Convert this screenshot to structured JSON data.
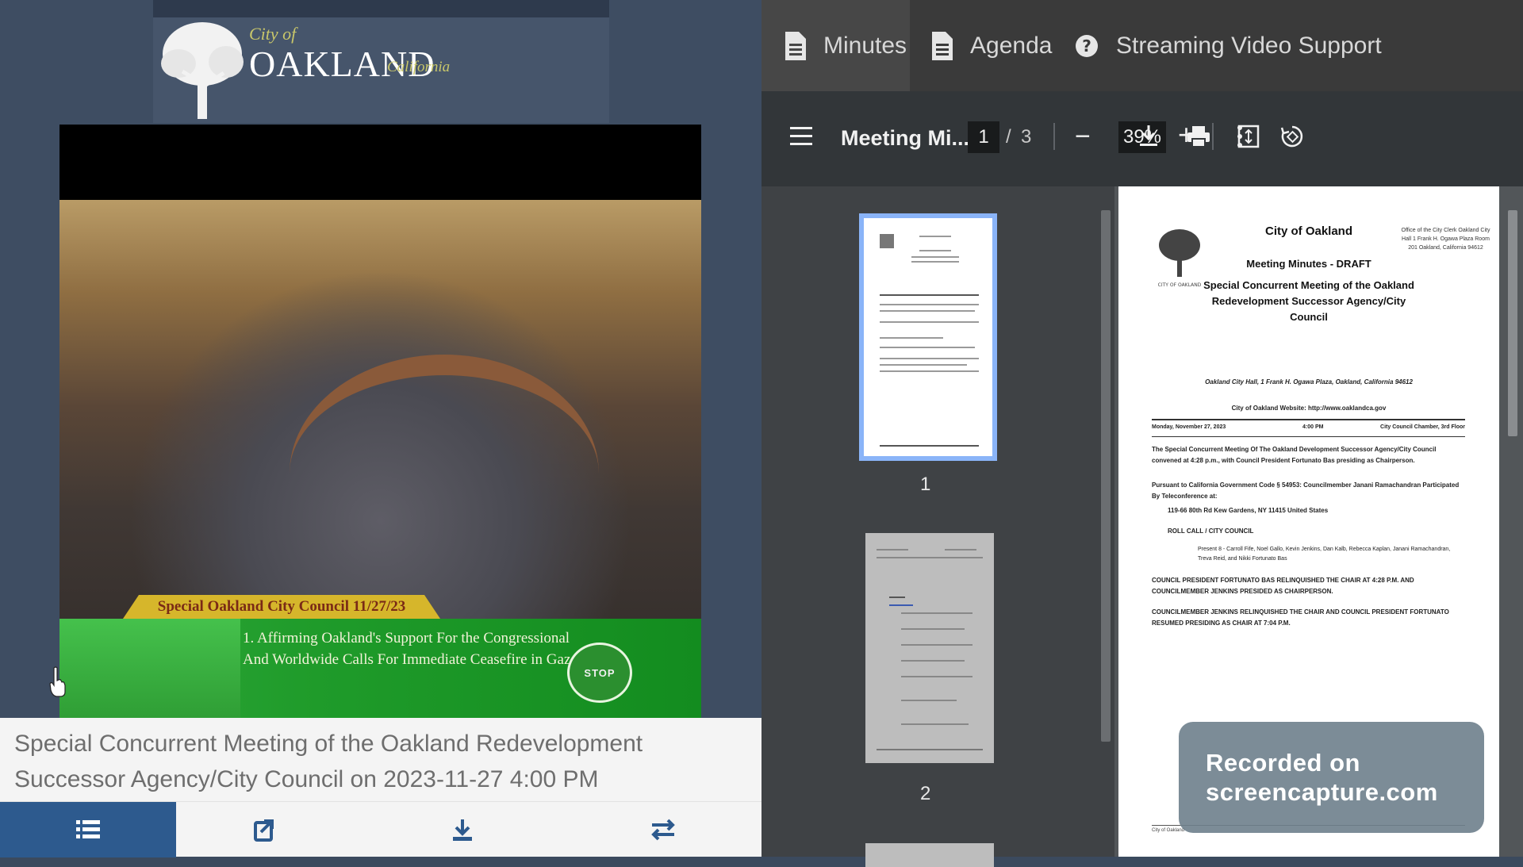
{
  "logo": {
    "city_of": "City of",
    "name": "OAKLAND",
    "state": "California"
  },
  "video": {
    "caption_date": "Special Oakland City Council  11/27/23",
    "caption_item": "1. Affirming Oakland's Support For the Congressional And Worldwide Calls For Immediate Ceasefire in Gaza",
    "badge": "STOP"
  },
  "meeting": {
    "title": "Special Concurrent Meeting of the Oakland Redevelopment Successor Agency/City Council on 2023-11-27 4:00 PM"
  },
  "bottom_tabs": [
    {
      "icon": "list-icon"
    },
    {
      "icon": "share-icon"
    },
    {
      "icon": "download-icon"
    },
    {
      "icon": "swap-icon"
    }
  ],
  "document_tabs": {
    "minutes": "Minutes",
    "agenda": "Agenda",
    "support": "Streaming Video Support"
  },
  "pdf_toolbar": {
    "title": "Meeting Mi...",
    "page_current": "1",
    "page_separator": "/",
    "page_total": "3",
    "zoom": "39%"
  },
  "thumbnails": {
    "page1": "1",
    "page2": "2"
  },
  "document": {
    "city": "City of Oakland",
    "office": "Office of the City Clerk Oakland City Hall 1 Frank H. Ogawa Plaza Room 201 Oakland, California 94612",
    "logo_caption": "CITY OF OAKLAND",
    "minutes_label": "Meeting Minutes - DRAFT",
    "meeting_name": "Special Concurrent Meeting of the Oakland Redevelopment Successor Agency/City Council",
    "address": "Oakland City Hall, 1 Frank H. Ogawa Plaza, Oakland, California 94612",
    "website": "City of Oakland Website:  http://www.oaklandca.gov",
    "date": "Monday, November 27, 2023",
    "time": "4:00 PM",
    "location": "City Council Chamber, 3rd Floor",
    "para1": "The Special Concurrent Meeting Of The Oakland Development Successor Agency/City Council convened at 4:28 p.m., with Council President Fortunato Bas presiding as Chairperson.",
    "para2": "Pursuant to California Government Code § 54953: Councilmember Janani Ramachandran Participated By Teleconference at:",
    "para3": "119-66 80th Rd Kew Gardens, NY 11415 United States",
    "roll_call": "ROLL CALL / CITY COUNCIL",
    "present": "Present   8 -   Carroll Fife, Noel Gallo, Kevin Jenkins, Dan Kalb, Rebecca Kaplan, Janani Ramachandran, Treva Reid, and Nikki Fortunato Bas",
    "para4": "COUNCIL PRESIDENT FORTUNATO BAS RELINQUISHED THE CHAIR AT 4:28 P.M. AND COUNCILMEMBER JENKINS PRESIDED AS CHAIRPERSON.",
    "para5": "COUNCILMEMBER JENKINS RELINQUISHED THE CHAIR AND COUNCIL PRESIDENT FORTUNATO RESUMED PRESIDING AS CHAIR AT 7:04 P.M.",
    "footer": "City of Oakland"
  },
  "watermark": {
    "line1": "Recorded on",
    "line2": "screencapture.com"
  },
  "colors": {
    "left_bg": "#3e4d62",
    "active_tab": "#2d5a8e",
    "caption_green": "#1f9b2a",
    "caption_gold": "#d6b62b",
    "thumb_highlight": "#8ab4f8"
  }
}
